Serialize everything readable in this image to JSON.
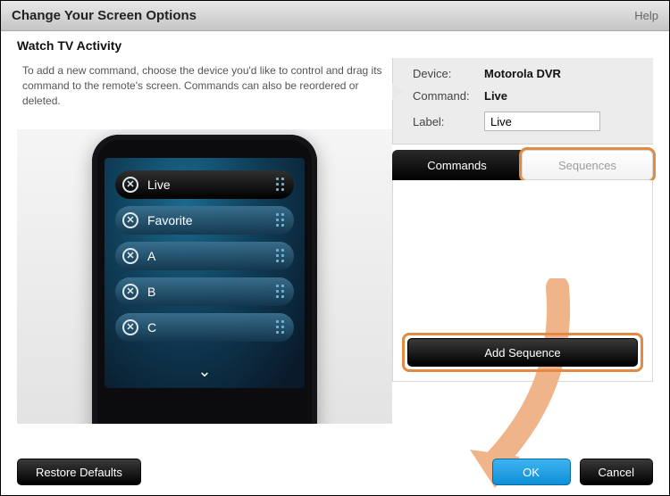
{
  "titlebar": {
    "title": "Change Your Screen Options",
    "help": "Help"
  },
  "subhead": "Watch TV Activity",
  "instructions": "To add a new command, choose the device you'd like to control and drag its command to the remote's screen. Commands can also be reordered or deleted.",
  "remote": {
    "rows": [
      {
        "label": "Live",
        "selected": true
      },
      {
        "label": "Favorite",
        "selected": false
      },
      {
        "label": "A",
        "selected": false
      },
      {
        "label": "B",
        "selected": false
      },
      {
        "label": "C",
        "selected": false
      }
    ]
  },
  "details": {
    "device_label": "Device:",
    "device_value": "Motorola DVR",
    "command_label": "Command:",
    "command_value": "Live",
    "label_label": "Label:",
    "label_value": "Live"
  },
  "tabs": {
    "commands": "Commands",
    "sequences": "Sequences"
  },
  "add_sequence": "Add Sequence",
  "footer": {
    "restore": "Restore Defaults",
    "ok": "OK",
    "cancel": "Cancel"
  },
  "colors": {
    "highlight": "#e08a43",
    "ok_blue": "#1a9be0"
  }
}
